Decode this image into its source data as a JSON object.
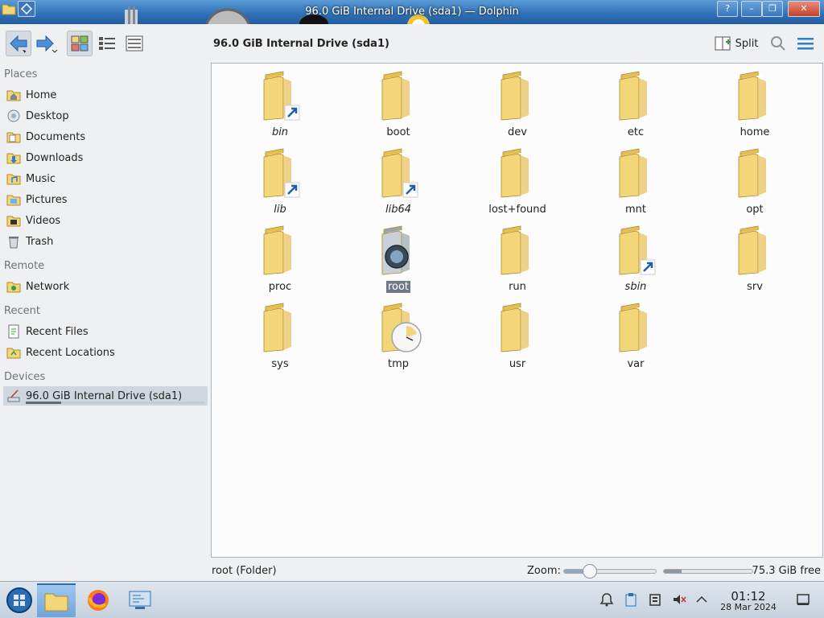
{
  "window": {
    "title": "96.0 GiB Internal Drive (sda1) — Dolphin",
    "controls": [
      "?",
      "–",
      "❐",
      "✕"
    ]
  },
  "toolbar": {
    "location_title": "96.0 GiB Internal Drive (sda1)",
    "split_label": "Split"
  },
  "sidebar": {
    "sections": [
      {
        "label": "Places",
        "items": [
          {
            "label": "Home",
            "icon": "home-icon"
          },
          {
            "label": "Desktop",
            "icon": "desktop-icon"
          },
          {
            "label": "Documents",
            "icon": "documents-icon"
          },
          {
            "label": "Downloads",
            "icon": "downloads-icon"
          },
          {
            "label": "Music",
            "icon": "music-icon"
          },
          {
            "label": "Pictures",
            "icon": "pictures-icon"
          },
          {
            "label": "Videos",
            "icon": "videos-icon"
          },
          {
            "label": "Trash",
            "icon": "trash-icon"
          }
        ]
      },
      {
        "label": "Remote",
        "items": [
          {
            "label": "Network",
            "icon": "network-icon"
          }
        ]
      },
      {
        "label": "Recent",
        "items": [
          {
            "label": "Recent Files",
            "icon": "recent-files-icon"
          },
          {
            "label": "Recent Locations",
            "icon": "recent-locations-icon"
          }
        ]
      },
      {
        "label": "Devices",
        "items": [
          {
            "label": "96.0 GiB Internal Drive (sda1)",
            "icon": "drive-icon",
            "selected": true,
            "used_fraction": 0.2
          }
        ]
      }
    ]
  },
  "files": [
    {
      "name": "bin",
      "link": true
    },
    {
      "name": "boot",
      "link": false
    },
    {
      "name": "dev",
      "link": false
    },
    {
      "name": "etc",
      "link": false
    },
    {
      "name": "home",
      "link": false
    },
    {
      "name": "lib",
      "link": true
    },
    {
      "name": "lib64",
      "link": true
    },
    {
      "name": "lost+found",
      "link": false
    },
    {
      "name": "mnt",
      "link": false
    },
    {
      "name": "opt",
      "link": false
    },
    {
      "name": "proc",
      "link": false
    },
    {
      "name": "root",
      "link": false,
      "selected": true,
      "special": "root"
    },
    {
      "name": "run",
      "link": false
    },
    {
      "name": "sbin",
      "link": true
    },
    {
      "name": "srv",
      "link": false
    },
    {
      "name": "sys",
      "link": false
    },
    {
      "name": "tmp",
      "link": false,
      "special": "tmp"
    },
    {
      "name": "usr",
      "link": false
    },
    {
      "name": "var",
      "link": false
    }
  ],
  "statusbar": {
    "status_text": "root (Folder)",
    "zoom_label": "Zoom:",
    "zoom_fraction": 0.28,
    "used_fraction": 0.2,
    "free_label": "75.3 GiB free"
  },
  "taskbar": {
    "time": "01:12",
    "date": "28 Mar 2024"
  },
  "colors": {
    "folder": "#f3d57a",
    "folder_dark": "#e5bf55",
    "selection": "#6f7a85",
    "accent": "#2f6fb4"
  }
}
